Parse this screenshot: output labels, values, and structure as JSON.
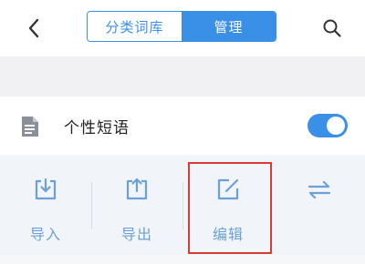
{
  "header": {
    "tabs": [
      {
        "label": "分类词库",
        "active": false
      },
      {
        "label": "管理",
        "active": true
      }
    ]
  },
  "setting": {
    "label": "个性短语",
    "enabled": true
  },
  "actions": [
    {
      "label": "导入",
      "icon": "import-icon"
    },
    {
      "label": "导出",
      "icon": "export-icon"
    },
    {
      "label": "编辑",
      "icon": "edit-icon"
    },
    {
      "label": "",
      "icon": "sync-icon"
    }
  ],
  "colors": {
    "accent": "#3a8fe6",
    "action_text": "#6ba1d8",
    "highlight": "#d83a34"
  }
}
